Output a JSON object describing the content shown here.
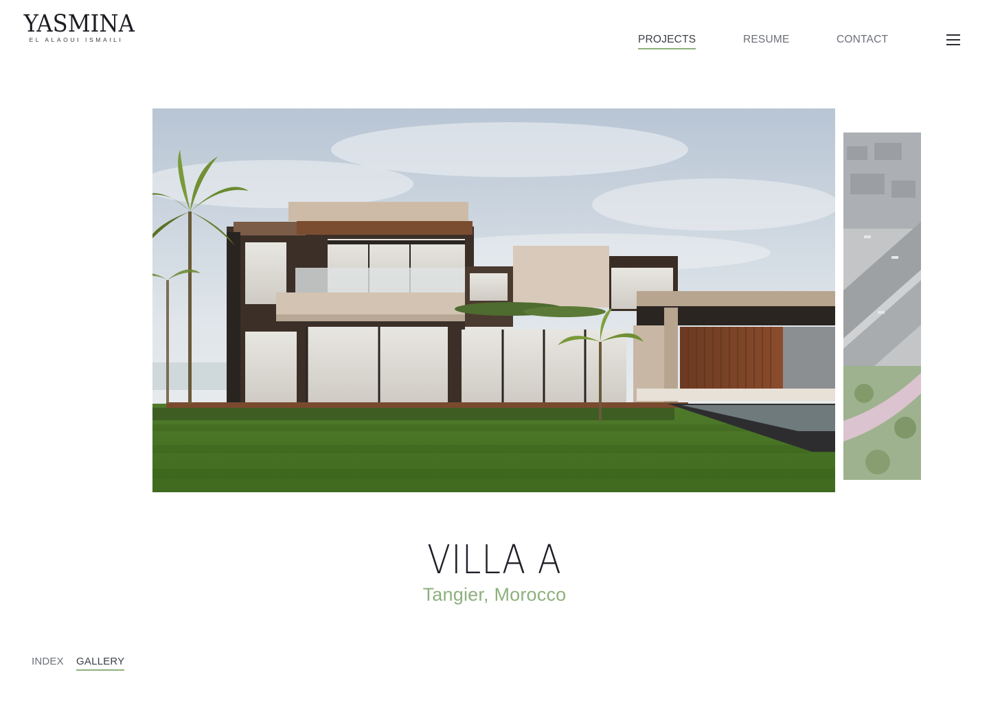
{
  "logo": {
    "name": "YASMINA",
    "subtitle": "EL ALAOUI ISMAILI"
  },
  "nav": {
    "items": [
      {
        "label": "PROJECTS",
        "active": true
      },
      {
        "label": "RESUME",
        "active": false
      },
      {
        "label": "CONTACT",
        "active": false
      }
    ],
    "menu_icon": "hamburger-menu-icon"
  },
  "project": {
    "title": "VILLA A",
    "location": "Tangier, Morocco"
  },
  "view_tabs": [
    {
      "label": "INDEX",
      "active": false
    },
    {
      "label": "GALLERY",
      "active": true
    }
  ],
  "colors": {
    "accent": "#8db07c",
    "text_dark": "#1d1e26",
    "nav_text": "#6b6f78"
  }
}
